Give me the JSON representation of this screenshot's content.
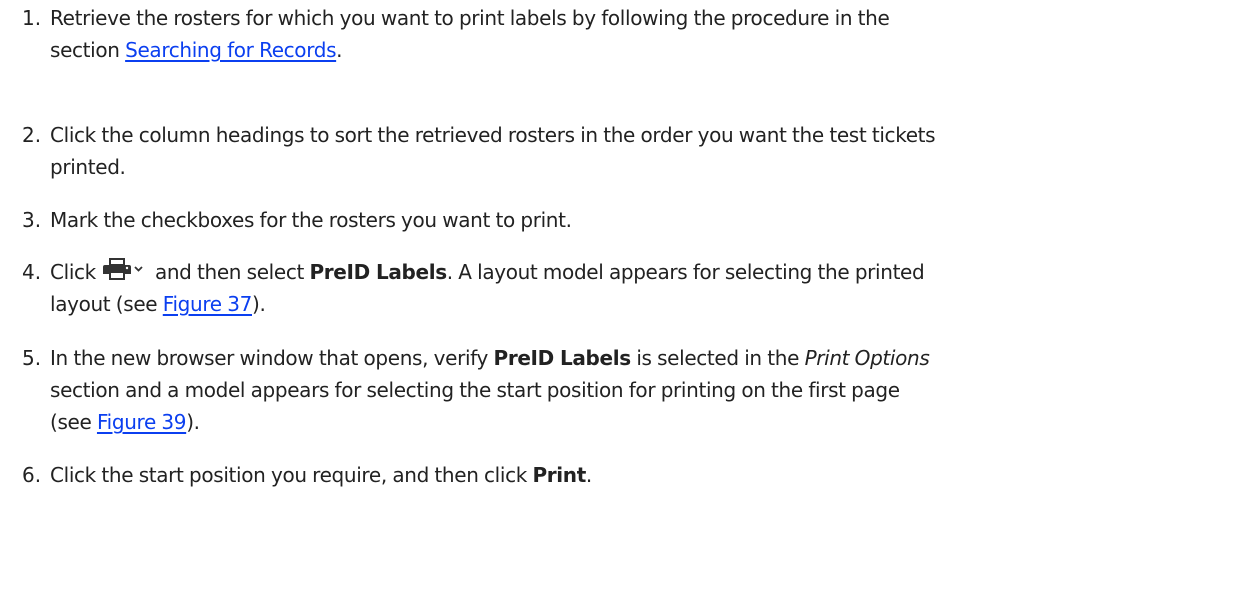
{
  "steps": [
    {
      "number": "1.",
      "lines": [
        "Retrieve the rosters for which you want to print labels by following the procedure in the",
        "section"
      ],
      "link": "Searching for Records",
      "after_link": "."
    },
    {
      "number": "2.",
      "lines": [
        "Click the column headings to sort the retrieved rosters in the order you want the test tickets",
        "printed."
      ]
    },
    {
      "number": "3.",
      "lines": [
        "Mark the checkboxes for the rosters you want to print."
      ]
    },
    {
      "number": "4.",
      "before_icon": "Click",
      "after_icon": "and then select",
      "bold": "PreID Labels",
      "after_bold": ". A layout model appears for selecting the printed",
      "line2_prefix": "layout (see",
      "link": "Figure 37",
      "line2_suffix": ")."
    },
    {
      "number": "5.",
      "prefix": "In the new browser window that opens, verify",
      "bold": "PreID Labels",
      "mid": "is selected in the",
      "italic": "Print Options",
      "line2": "section and a model appears for selecting the start position for printing on the first page",
      "line3_prefix": "(see",
      "link": "Figure 39",
      "line3_suffix": ")."
    },
    {
      "number": "6.",
      "prefix": "Click the start position you require, and then click",
      "bold": "Print",
      "suffix": "."
    }
  ],
  "icons": {
    "print_menu": "printer-icon"
  },
  "colors": {
    "link": "#0b3ff0",
    "text": "#222222",
    "icon": "#333333"
  }
}
